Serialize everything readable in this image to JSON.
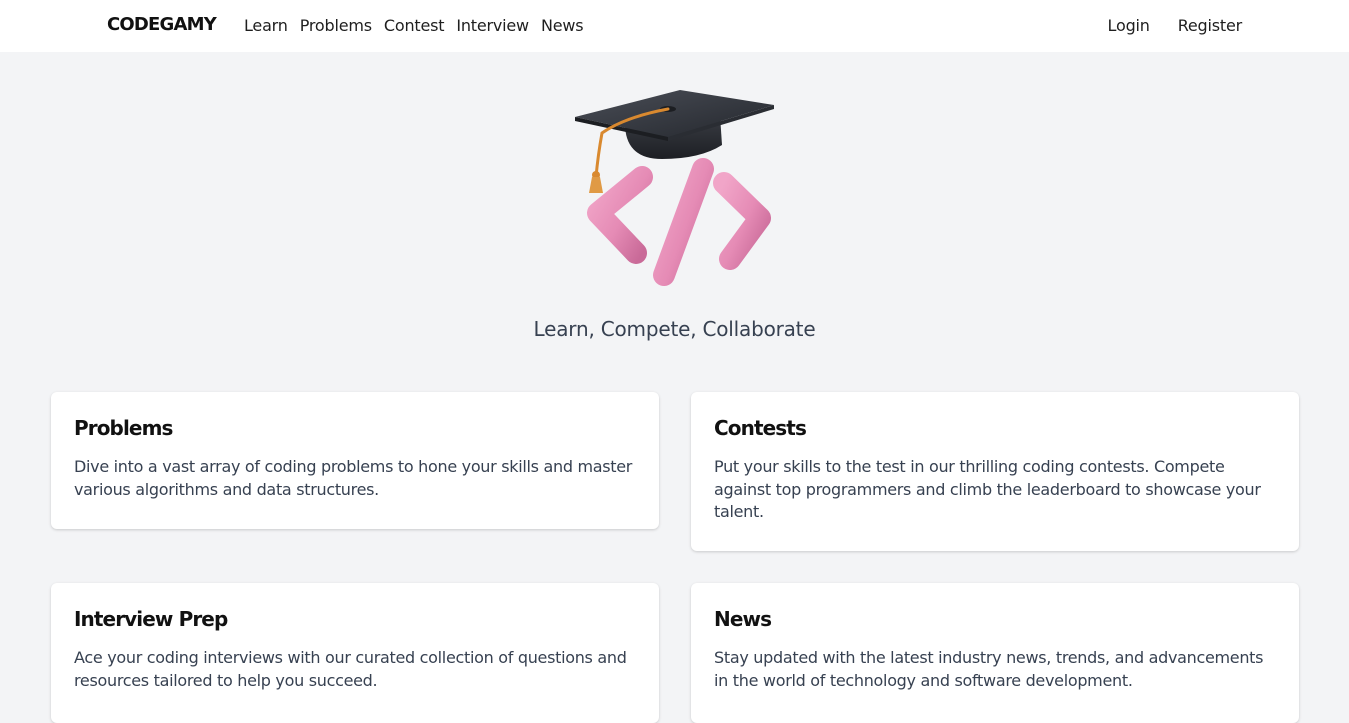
{
  "nav": {
    "logo": "CODEGAMY",
    "links": [
      "Learn",
      "Problems",
      "Contest",
      "Interview",
      "News"
    ],
    "login": "Login",
    "register": "Register"
  },
  "hero": {
    "icon": "graduation-cap-code-icon",
    "tagline": "Learn, Compete, Collaborate"
  },
  "cards": [
    {
      "title": "Problems",
      "description": "Dive into a vast array of coding problems to hone your skills and master various algorithms and data structures."
    },
    {
      "title": "Contests",
      "description": "Put your skills to the test in our thrilling coding contests. Compete against top programmers and climb the leaderboard to showcase your talent."
    },
    {
      "title": "Interview Prep",
      "description": "Ace your coding interviews with our curated collection of questions and resources tailored to help you succeed."
    },
    {
      "title": "News",
      "description": "Stay updated with the latest industry news, trends, and advancements in the world of technology and software development."
    }
  ],
  "colors": {
    "page_background": "#f3f4f6",
    "nav_background": "#ffffff",
    "card_background": "#ffffff",
    "code_symbol_pink": "#e58bb5",
    "cap_dark": "#2f3238",
    "tassel_orange": "#d9892f"
  }
}
